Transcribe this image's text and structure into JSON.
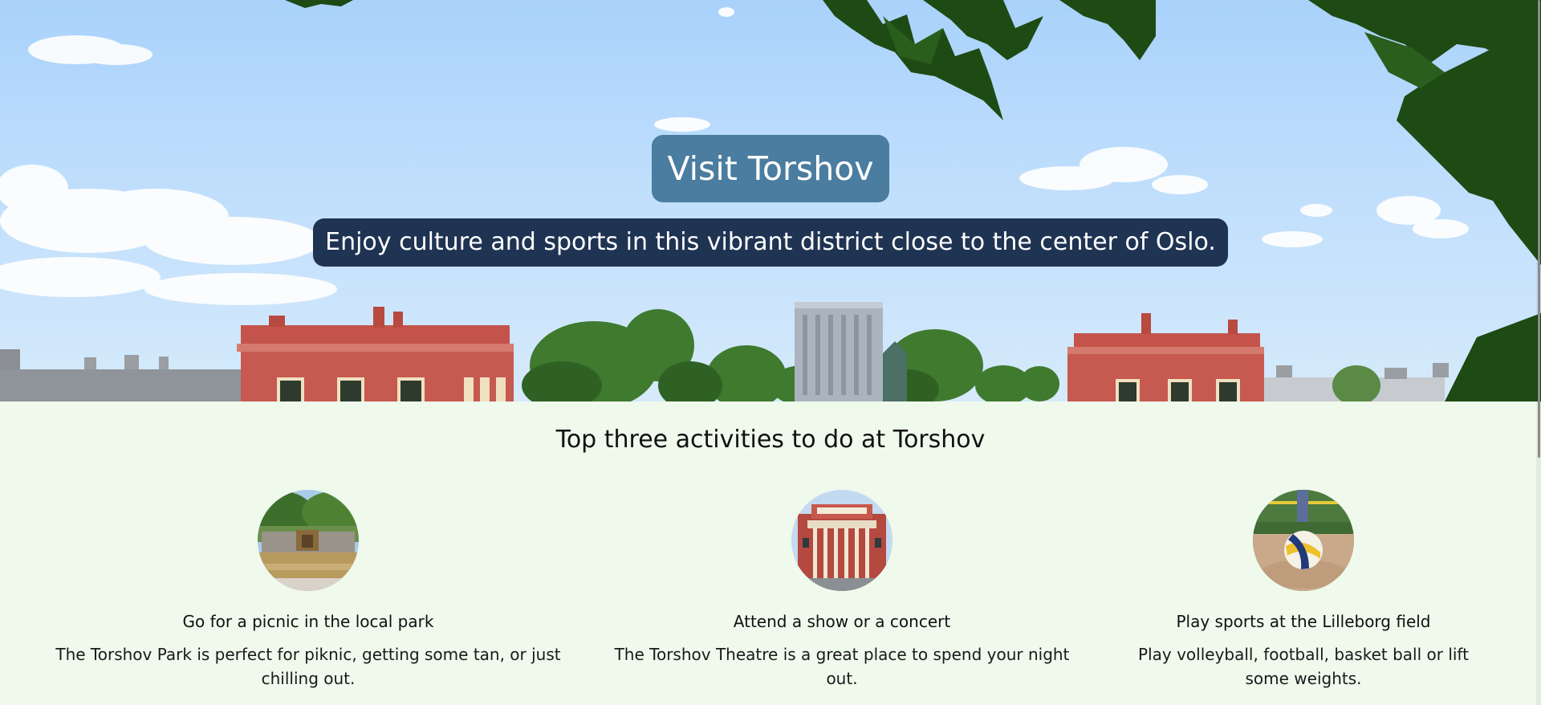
{
  "hero": {
    "title": "Visit Torshov",
    "subtitle": "Enjoy culture and sports in this vibrant district close to the center of Oslo."
  },
  "activities": {
    "heading": "Top three activities to do at Torshov",
    "items": [
      {
        "title": "Go for a picnic in the local park",
        "text": "The Torshov Park is perfect for piknic, getting some tan, or just chilling out."
      },
      {
        "title": "Attend a show or a concert",
        "text": "The Torshov Theatre is a great place to spend your night out."
      },
      {
        "title": "Play sports at the Lilleborg field",
        "text": "Play volleyball, football, basket ball or lift some weights."
      }
    ]
  },
  "colors": {
    "page_background": "#eff9ec",
    "title_badge": "#4a7d9f",
    "subtitle_badge": "#1f3352",
    "text": "#111111"
  }
}
